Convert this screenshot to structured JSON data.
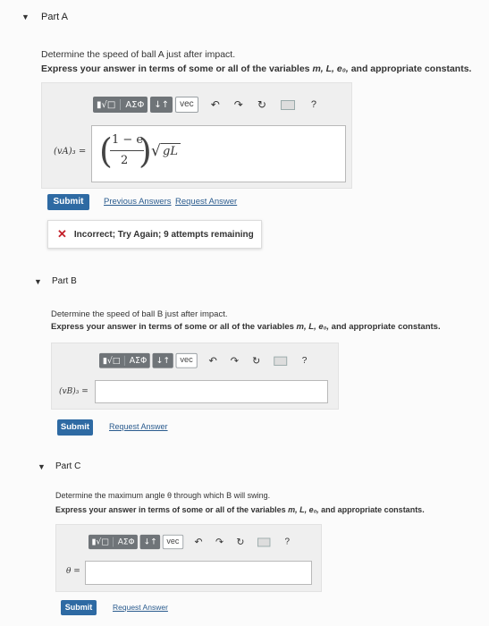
{
  "toolbar": {
    "templates_icon": "templates-icon",
    "greek_label": "ΑΣΦ",
    "arrows_label": "↓↑",
    "vec_label": "vec",
    "undo_icon": "↶",
    "redo_icon": "↷",
    "reset_icon": "↻",
    "keyboard_icon": "keyboard-icon",
    "help_label": "?"
  },
  "partA": {
    "title": "Part A",
    "question": "Determine the speed of ball A just after impact.",
    "instruction_prefix": "Express your answer in terms of some or all of the variables ",
    "instruction_vars": "m, L, e₀,",
    "instruction_suffix": " and appropriate constants.",
    "answer_label": "(vA)₃ =",
    "answer": {
      "numerator": "1 − e",
      "denominator": "2",
      "radical": "gL"
    },
    "submit_label": "Submit",
    "previous_answers_label": "Previous Answers",
    "request_answer_label": "Request Answer",
    "feedback": "Incorrect; Try Again; 9 attempts remaining"
  },
  "partB": {
    "title": "Part B",
    "question": "Determine the speed of ball B just after impact.",
    "instruction_prefix": "Express your answer in terms of some or all of the variables ",
    "instruction_vars": "m, L, e₀,",
    "instruction_suffix": " and appropriate constants.",
    "answer_label": "(vB)₃ =",
    "submit_label": "Submit",
    "request_answer_label": "Request Answer"
  },
  "partC": {
    "title": "Part C",
    "question": "Determine the maximum angle θ through which B will swing.",
    "instruction_prefix": "Express your answer in terms of some or all of the variables ",
    "instruction_vars": "m, L, e₀,",
    "instruction_suffix": " and appropriate constants.",
    "answer_label": "θ =",
    "submit_label": "Submit",
    "request_answer_label": "Request Answer"
  },
  "colors": {
    "submit": "#2e6aa3",
    "link": "#2a5b8e",
    "error": "#c4202a",
    "toolbar": "#6f7478"
  }
}
